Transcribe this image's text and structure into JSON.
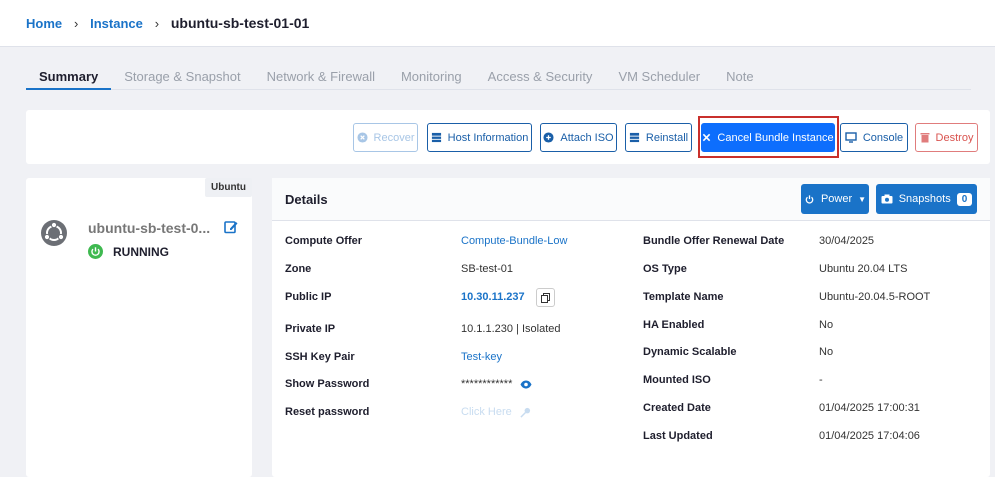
{
  "breadcrumb": {
    "home": "Home",
    "instance": "Instance",
    "current": "ubuntu-sb-test-01-01"
  },
  "tabs": [
    "Summary",
    "Storage & Snapshot",
    "Network & Firewall",
    "Monitoring",
    "Access & Security",
    "VM Scheduler",
    "Note"
  ],
  "actions": {
    "recover": "Recover",
    "host_info": "Host Information",
    "attach_iso": "Attach ISO",
    "reinstall": "Reinstall",
    "cancel_bundle": "Cancel Bundle Instance",
    "console": "Console",
    "destroy": "Destroy"
  },
  "instance": {
    "os_badge": "Ubuntu",
    "name": "ubuntu-sb-test-0...",
    "status": "RUNNING"
  },
  "details": {
    "title": "Details",
    "power_label": "Power",
    "snapshots_label": "Snapshots",
    "snapshots_count": "0",
    "left": [
      {
        "label": "Compute Offer",
        "value": "Compute-Bundle-Low"
      },
      {
        "label": "Zone",
        "value": "SB-test-01"
      },
      {
        "label": "Public IP",
        "value": "10.30.11.237"
      },
      {
        "label": "Private IP",
        "value": "10.1.1.230 | Isolated"
      },
      {
        "label": "SSH Key Pair",
        "value": "Test-key"
      },
      {
        "label": "Show Password",
        "value": "************"
      },
      {
        "label": "Reset password",
        "value": "Click Here"
      }
    ],
    "right": [
      {
        "label": "Bundle Offer Renewal Date",
        "value": "30/04/2025"
      },
      {
        "label": "OS Type",
        "value": "Ubuntu 20.04 LTS"
      },
      {
        "label": "Template Name",
        "value": "Ubuntu-20.04.5-ROOT"
      },
      {
        "label": "HA Enabled",
        "value": "No"
      },
      {
        "label": "Dynamic Scalable",
        "value": "No"
      },
      {
        "label": "Mounted ISO",
        "value": "-"
      },
      {
        "label": "Created Date",
        "value": "01/04/2025 17:00:31"
      },
      {
        "label": "Last Updated",
        "value": "01/04/2025 17:04:06"
      }
    ]
  },
  "colors": {
    "primary": "#1a73c8",
    "danger": "#d9534f",
    "highlight": "#c9302c",
    "running": "#3fb950"
  },
  "icons": [
    "chevron-right-icon",
    "recover-icon",
    "server-icon",
    "disc-icon",
    "reinstall-icon",
    "close-icon",
    "monitor-icon",
    "trash-icon",
    "ubuntu-icon",
    "edit-icon",
    "power-icon",
    "camera-icon",
    "copy-icon",
    "eye-icon",
    "key-icon"
  ]
}
